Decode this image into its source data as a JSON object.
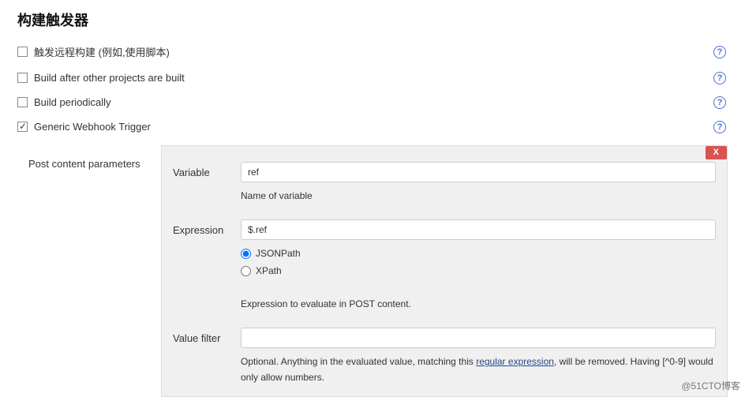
{
  "section_title": "构建触发器",
  "triggers": {
    "remote": {
      "label": "触发远程构建 (例如,使用脚本)",
      "checked": false
    },
    "after_projects": {
      "label": "Build after other projects are built",
      "checked": false
    },
    "periodically": {
      "label": "Build periodically",
      "checked": false
    },
    "generic_webhook": {
      "label": "Generic Webhook Trigger",
      "checked": true
    }
  },
  "post_content": {
    "heading": "Post content parameters",
    "close_label": "X",
    "variable": {
      "label": "Variable",
      "value": "ref",
      "hint": "Name of variable"
    },
    "expression": {
      "label": "Expression",
      "value": "$.ref",
      "jsonpath_label": "JSONPath",
      "xpath_label": "XPath",
      "hint": "Expression to evaluate in POST content."
    },
    "value_filter": {
      "label": "Value filter",
      "value": "",
      "hint_before": "Optional. Anything in the evaluated value, matching this ",
      "link_text": "regular expression",
      "hint_after": ", will be removed. Having [^0-9] would only allow numbers."
    }
  },
  "watermark": "@51CTO博客"
}
